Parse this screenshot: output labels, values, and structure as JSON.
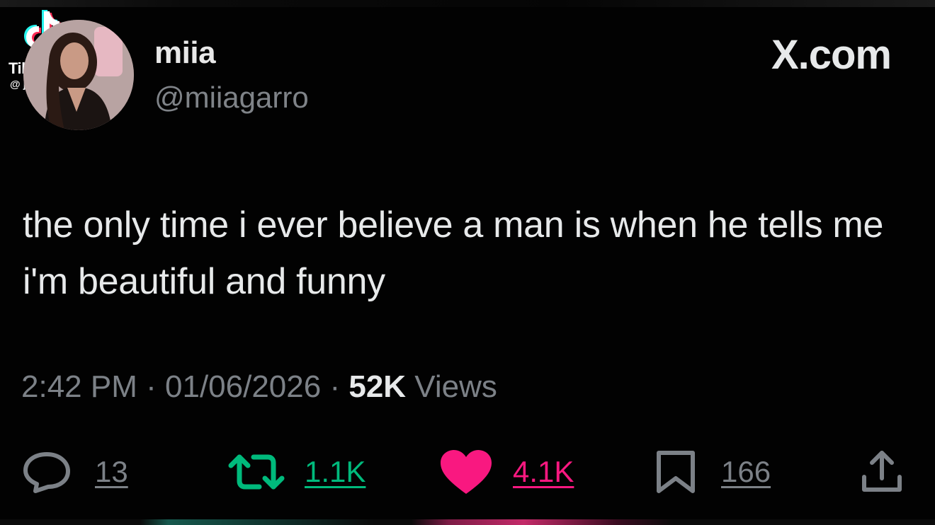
{
  "watermark": {
    "app_name": "TikTok",
    "handle": "@ jjlegh",
    "icon": "tiktok-logo-icon"
  },
  "header": {
    "display_name": "miia",
    "username": "@miiagarro",
    "site": "X.com"
  },
  "tweet": {
    "text": "the only time i ever believe a man is when he tells me i'm beautiful and funny"
  },
  "meta": {
    "time": "2:42 PM",
    "separator": "·",
    "date": "01/06/2026",
    "views_count": "52K",
    "views_label": "Views"
  },
  "actions": {
    "reply": {
      "icon": "reply-icon",
      "count": "13"
    },
    "retweet": {
      "icon": "retweet-icon",
      "count": "1.1K"
    },
    "like": {
      "icon": "heart-icon",
      "count": "4.1K"
    },
    "bookmark": {
      "icon": "bookmark-icon",
      "count": "166"
    },
    "share": {
      "icon": "share-icon"
    }
  },
  "colors": {
    "background": "#000000",
    "text": "#e7e9ea",
    "secondary": "#7c8187",
    "retweet": "#00ba7c",
    "like": "#f91880"
  }
}
